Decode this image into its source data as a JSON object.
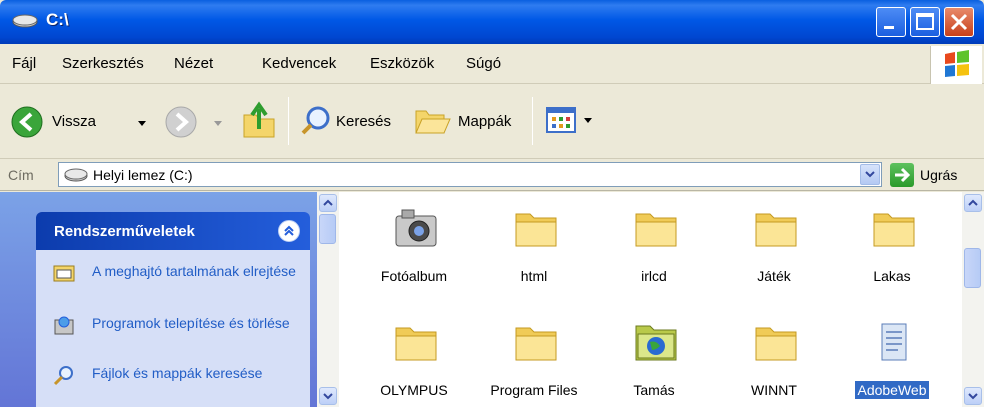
{
  "window": {
    "title": "C:\\"
  },
  "menu": [
    "Fájl",
    "Szerkesztés",
    "Nézet",
    "Kedvencek",
    "Eszközök",
    "Súgó"
  ],
  "toolbar": {
    "back_label": "Vissza",
    "search_label": "Keresés",
    "folders_label": "Mappák"
  },
  "address": {
    "label": "Cím",
    "value": "Helyi lemez (C:)",
    "go_label": "Ugrás"
  },
  "tasks": {
    "title": "Rendszerműveletek",
    "items": [
      {
        "label": "A meghajtó tartalmának elrejtése",
        "icon": "hide-contents-icon"
      },
      {
        "label": "Programok telepítése és törlése",
        "icon": "add-remove-programs-icon"
      },
      {
        "label": "Fájlok és mappák keresése",
        "icon": "search-icon"
      }
    ]
  },
  "files": [
    {
      "name": "Fotóalbum",
      "icon": "camera-icon"
    },
    {
      "name": "html",
      "icon": "folder-icon"
    },
    {
      "name": "irlcd",
      "icon": "folder-icon"
    },
    {
      "name": "Játék",
      "icon": "folder-icon"
    },
    {
      "name": "Lakas",
      "icon": "folder-icon"
    },
    {
      "name": "OLYMPUS",
      "icon": "folder-icon"
    },
    {
      "name": "Program Files",
      "icon": "folder-icon"
    },
    {
      "name": "Tamás",
      "icon": "globe-folder-icon"
    },
    {
      "name": "WINNT",
      "icon": "folder-icon"
    },
    {
      "name": "AdobeWeb",
      "icon": "document-icon",
      "selected": true
    }
  ],
  "colors": {
    "titlebar": "#0054e3",
    "selection": "#316ac5",
    "task_pane": "#6f8fe0",
    "link": "#215dc6"
  }
}
